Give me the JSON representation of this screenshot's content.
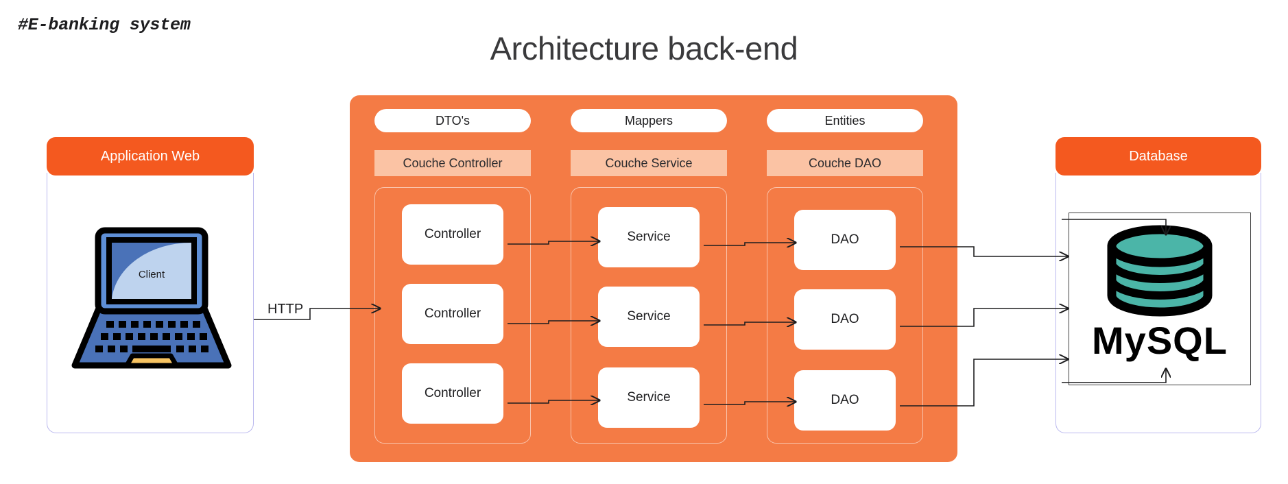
{
  "kicker": "#E-banking system",
  "title": "Architecture back-end",
  "colors": {
    "panel_orange": "#F47B45",
    "header_orange": "#F4591F",
    "layer_peach": "#FBC3A4",
    "card_border": "#b9b7ee",
    "mysql_teal": "#4BB5A8",
    "laptop_blue": "#4A72B8",
    "laptop_screen_light": "#BED3EE",
    "laptop_trackpad": "#F8C462"
  },
  "left_card": {
    "header": "Application Web",
    "laptop": {
      "screen_label": "Client"
    }
  },
  "connector": {
    "http_label": "HTTP"
  },
  "panel": {
    "columns": [
      {
        "pill": "DTO's",
        "layer": "Couche Controller",
        "nodes": [
          "Controller",
          "Controller",
          "Controller"
        ]
      },
      {
        "pill": "Mappers",
        "layer": "Couche Service",
        "nodes": [
          "Service",
          "Service",
          "Service"
        ]
      },
      {
        "pill": "Entities",
        "layer": "Couche DAO",
        "nodes": [
          "DAO",
          "DAO",
          "DAO"
        ]
      }
    ]
  },
  "right_card": {
    "header": "Database",
    "db_logo_label": "MySQL"
  }
}
